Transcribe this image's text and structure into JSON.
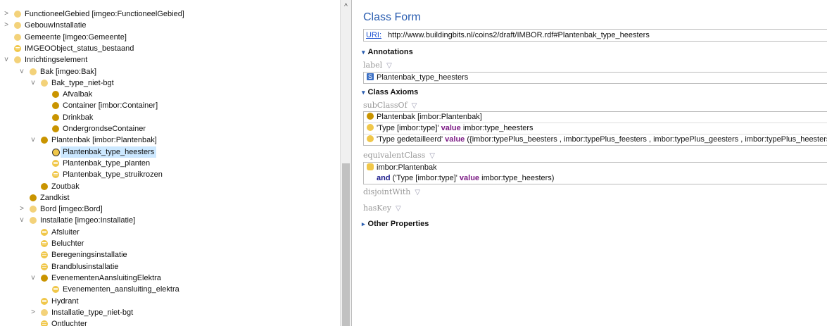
{
  "tree": [
    {
      "label": "FunctioneelGebied [imgeo:FunctioneelGebied]",
      "chev": ">",
      "icon": "light"
    },
    {
      "label": "GebouwInstallatie",
      "chev": ">",
      "icon": "light"
    },
    {
      "label": "Gemeente [imgeo:Gemeente]",
      "chev": "",
      "icon": "light"
    },
    {
      "label": "IMGEOObject_status_bestaand",
      "chev": "",
      "icon": "def"
    },
    {
      "label": "Inrichtingselement",
      "chev": "v",
      "icon": "light"
    },
    {
      "label": "Bak [imgeo:Bak]",
      "chev": "v",
      "icon": "light"
    },
    {
      "label": "Bak_type_niet-bgt",
      "chev": "v",
      "icon": "light"
    },
    {
      "label": "Afvalbak",
      "chev": "",
      "icon": "dark"
    },
    {
      "label": "Container [imbor:Container]",
      "chev": "",
      "icon": "dark"
    },
    {
      "label": "Drinkbak",
      "chev": "",
      "icon": "dark"
    },
    {
      "label": "OndergrondseContainer",
      "chev": "",
      "icon": "dark"
    },
    {
      "label": "Plantenbak [imbor:Plantenbak]",
      "chev": "v",
      "icon": "dark"
    },
    {
      "label": "Plantenbak_type_heesters",
      "chev": "",
      "icon": "sel"
    },
    {
      "label": "Plantenbak_type_planten",
      "chev": "",
      "icon": "def"
    },
    {
      "label": "Plantenbak_type_struikrozen",
      "chev": "",
      "icon": "def"
    },
    {
      "label": "Zoutbak",
      "chev": "",
      "icon": "dark"
    },
    {
      "label": "Zandkist",
      "chev": "",
      "icon": "dark"
    },
    {
      "label": "Bord [imgeo:Bord]",
      "chev": ">",
      "icon": "light"
    },
    {
      "label": "Installatie [imgeo:Installatie]",
      "chev": "v",
      "icon": "light"
    },
    {
      "label": "Afsluiter",
      "chev": "",
      "icon": "def"
    },
    {
      "label": "Beluchter",
      "chev": "",
      "icon": "def"
    },
    {
      "label": "Beregeningsinstallatie",
      "chev": "",
      "icon": "def"
    },
    {
      "label": "Brandblusinstallatie",
      "chev": "",
      "icon": "def"
    },
    {
      "label": "EvenementenAansluitingElektra",
      "chev": "v",
      "icon": "dark"
    },
    {
      "label": "Evenementen_aansluiting_elektra",
      "chev": "",
      "icon": "def"
    },
    {
      "label": "Hydrant",
      "chev": "",
      "icon": "def"
    },
    {
      "label": "Installatie_type_niet-bgt",
      "chev": ">",
      "icon": "light"
    },
    {
      "label": "Ontluchter",
      "chev": "",
      "icon": "def"
    }
  ],
  "scroll_up": "^",
  "form": {
    "title": "Class Form",
    "uri_label": "URI:",
    "uri_value": "http://www.buildingbits.nl/coins2/draft/IMBOR.rdf#Plantenbak_type_heesters",
    "annotations": "Annotations",
    "label_prop": "label",
    "label_value": "Plantenbak_type_heesters",
    "class_axioms": "Class Axioms",
    "subclassof": "subClassOf",
    "sub1": "Plantenbak  [imbor:Plantenbak]",
    "sub2_a": "'Type  [imbor:type]'",
    "sub2_kw": "value",
    "sub2_b": "imbor:type_heesters",
    "sub3_a": "'Type gedetailleerd'",
    "sub3_kw": "value",
    "sub3_b": "({imbor:typePlus_beesters , imbor:typePlus_feesters , imbor:typePlus_geesters , imbor:typePlus_heesters})",
    "equivalentclass": "equivalentClass",
    "eq1": "imbor:Plantenbak",
    "eq2_and": "and",
    "eq2_a": "('Type  [imbor:type]'",
    "eq2_kw": "value",
    "eq2_b": "imbor:type_heesters)",
    "disjointwith": "disjointWith",
    "haskey": "hasKey",
    "other": "Other Properties",
    "add_glyph": "▽",
    "tri_down": "▾",
    "tri_right": "▸",
    "s_glyph": "S"
  }
}
